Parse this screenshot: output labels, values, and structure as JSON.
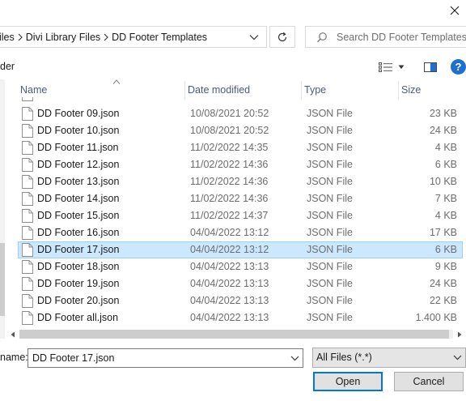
{
  "title_bar": {
    "close_glyph": "✕"
  },
  "address_bar": {
    "crumbs": [
      "iles",
      "Divi Library Files",
      "DD Footer Templates"
    ]
  },
  "search": {
    "placeholder": "Search DD Footer Templates"
  },
  "toolbar": {
    "new_folder_label": "der",
    "help_label": "?"
  },
  "columns": {
    "name": "Name",
    "date": "Date modified",
    "type": "Type",
    "size": "Size"
  },
  "files": [
    {
      "name": "DD Footer 09.json",
      "date": "10/08/2021 20:52",
      "type": "JSON File",
      "size": "23 KB"
    },
    {
      "name": "DD Footer 10.json",
      "date": "10/08/2021 20:52",
      "type": "JSON File",
      "size": "24 KB"
    },
    {
      "name": "DD Footer 11.json",
      "date": "11/02/2022 14:35",
      "type": "JSON File",
      "size": "4 KB"
    },
    {
      "name": "DD Footer 12.json",
      "date": "11/02/2022 14:36",
      "type": "JSON File",
      "size": "6 KB"
    },
    {
      "name": "DD Footer 13.json",
      "date": "11/02/2022 14:36",
      "type": "JSON File",
      "size": "10 KB"
    },
    {
      "name": "DD Footer 14.json",
      "date": "11/02/2022 14:36",
      "type": "JSON File",
      "size": "7 KB"
    },
    {
      "name": "DD Footer 15.json",
      "date": "11/02/2022 14:37",
      "type": "JSON File",
      "size": "4 KB"
    },
    {
      "name": "DD Footer 16.json",
      "date": "04/04/2022 13:12",
      "type": "JSON File",
      "size": "17 KB"
    },
    {
      "name": "DD Footer 17.json",
      "date": "04/04/2022 13:12",
      "type": "JSON File",
      "size": "6 KB",
      "selected": true
    },
    {
      "name": "DD Footer 18.json",
      "date": "04/04/2022 13:13",
      "type": "JSON File",
      "size": "9 KB"
    },
    {
      "name": "DD Footer 19.json",
      "date": "04/04/2022 13:13",
      "type": "JSON File",
      "size": "24 KB"
    },
    {
      "name": "DD Footer 20.json",
      "date": "04/04/2022 13:13",
      "type": "JSON File",
      "size": "22 KB"
    },
    {
      "name": "DD Footer all.json",
      "date": "04/04/2022 13:13",
      "type": "JSON File",
      "size": "1.400 KB"
    }
  ],
  "bottom": {
    "filename_label": "name:",
    "filename_value": "DD Footer 17.json",
    "filetype_value": "All Files (*.*)",
    "open_label": "Open",
    "cancel_label": "Cancel"
  },
  "colors": {
    "accent": "#0078d7",
    "selection": "#cce8ff",
    "help": "#1f6fd1"
  }
}
